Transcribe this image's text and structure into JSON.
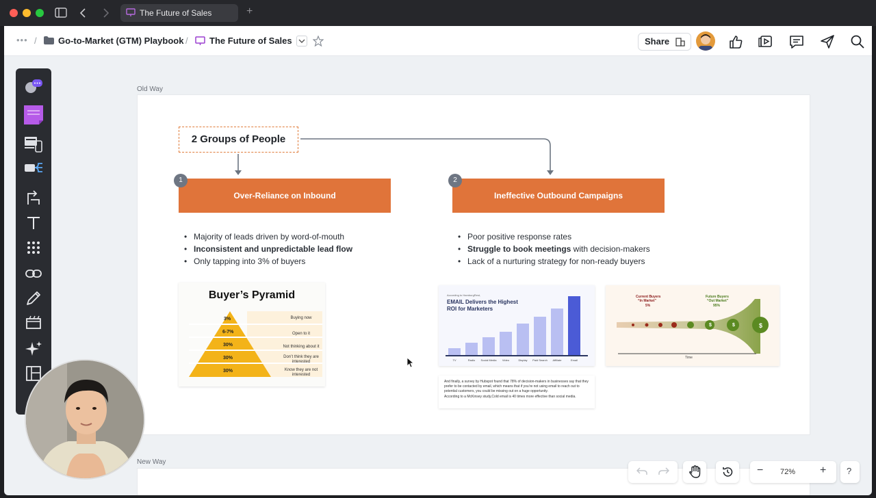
{
  "titlebar": {
    "tab_title": "The Future of Sales",
    "new_tab": "+"
  },
  "breadcrumb": {
    "more": "•••",
    "sep": "/",
    "folder": "Go-to-Market (GTM) Playbook",
    "page": "The Future of Sales"
  },
  "header": {
    "share_label": "Share"
  },
  "frames": {
    "old_label": "Old Way",
    "new_label": "New Way"
  },
  "diagram": {
    "root": "2 Groups of People",
    "left": {
      "num": "1",
      "title": "Over-Reliance on Inbound",
      "bullets": [
        "Majority of leads driven by word-of-mouth",
        "Inconsistent and unpredictable lead flow",
        "Only tapping into 3% of buyers"
      ]
    },
    "right": {
      "num": "2",
      "title": "Ineffective Outbound Campaigns",
      "bullet1": "Poor positive response rates",
      "bullet2_bold": "Struggle to book meetings",
      "bullet2_rest": " with decision-makers",
      "bullet3": "Lack of a nurturing strategy for non-ready buyers"
    }
  },
  "pyramid": {
    "title": "Buyer’s Pyramid",
    "levels": [
      {
        "pct": "3%",
        "label": "Buying now"
      },
      {
        "pct": "6-7%",
        "label": "Open to it"
      },
      {
        "pct": "30%",
        "label": "Not thinking about it"
      },
      {
        "pct": "30%",
        "label": "Don’t think they are interested"
      },
      {
        "pct": "30%",
        "label": "Know they are not interested"
      }
    ]
  },
  "email_chart": {
    "sub": "According to HamburgRest,",
    "title_line1": "EMAIL Delivers the Highest",
    "title_line2": "ROI for Marketers",
    "categories": [
      "TV",
      "Radio",
      "Social Media",
      "Video",
      "Display",
      "Paid Search",
      "Affiliate",
      "Email"
    ]
  },
  "funnel": {
    "current": "Current Buyers",
    "current_sub": "“In Market”",
    "current_pct": "5%",
    "future": "Future Buyers",
    "future_sub": "“Out Market”",
    "future_pct": "95%",
    "axis": "Time",
    "coin": "$"
  },
  "note": {
    "line1": "And finally, a survey by Hubspot found that 78% of decision-makers in businesses say that they prefer to be contacted by email, which means that if you’re not using email to reach out to potential customers, you could be missing out on a huge opportunity.",
    "line2": "According to a McKinsey study,Cold email is 40 times more effective than social media."
  },
  "zoom": {
    "level": "72%",
    "minus": "−",
    "plus": "+",
    "help": "?"
  },
  "colors": {
    "accent_orange": "#e0743a",
    "badge_gray": "#6e7683",
    "pyramid_yellow": "#f3b319",
    "chart_blue": "#4b5bd6"
  }
}
